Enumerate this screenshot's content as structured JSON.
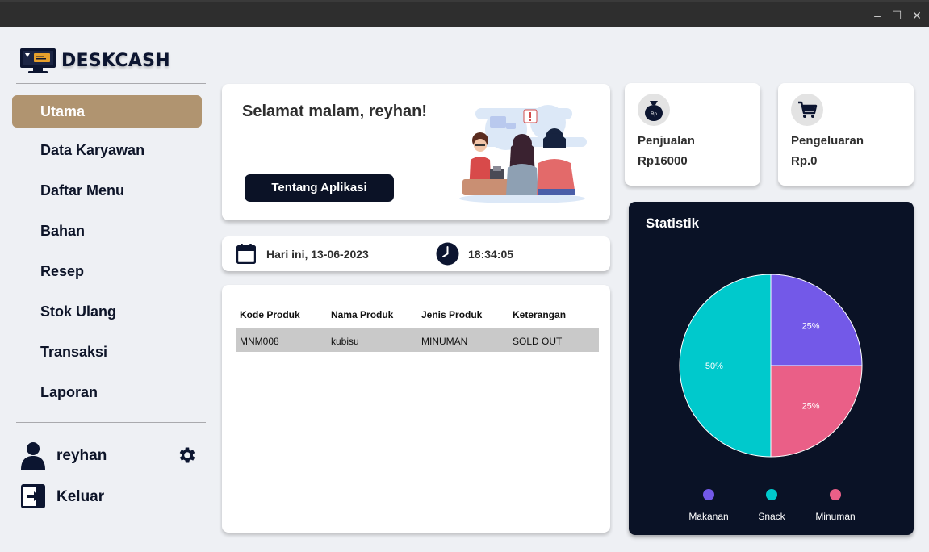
{
  "window": {
    "minimize": "–",
    "maximize": "☐",
    "close": "✕"
  },
  "app": {
    "title": "DESKCASH"
  },
  "nav": {
    "items": [
      {
        "label": "Utama"
      },
      {
        "label": "Data Karyawan"
      },
      {
        "label": "Daftar Menu"
      },
      {
        "label": "Bahan"
      },
      {
        "label": "Resep"
      },
      {
        "label": "Stok Ulang"
      },
      {
        "label": "Transaksi"
      },
      {
        "label": "Laporan"
      }
    ],
    "active_index": 0
  },
  "user": {
    "name": "reyhan",
    "logout_label": "Keluar"
  },
  "greeting": {
    "text": "Selamat malam, reyhan!",
    "about_button": "Tentang Aplikasi"
  },
  "datetime": {
    "date": "Hari ini, 13-06-2023",
    "time": "18:34:05"
  },
  "table": {
    "headers": [
      "Kode Produk",
      "Nama Produk",
      "Jenis Produk",
      "Keterangan"
    ],
    "rows": [
      [
        "MNM008",
        "kubisu",
        "MINUMAN",
        "SOLD OUT"
      ]
    ]
  },
  "stats": {
    "sales": {
      "label": "Penjualan",
      "value": "Rp16000",
      "badge": "Rp"
    },
    "expenses": {
      "label": "Pengeluaran",
      "value": "Rp.0"
    }
  },
  "colors": {
    "accent": "#b09470",
    "dark": "#0a1226",
    "makanan": "#7359e8",
    "snack": "#00c9cc",
    "minuman": "#ea5f87"
  },
  "chart_data": {
    "type": "pie",
    "title": "Statistik",
    "categories": [
      "Makanan",
      "Snack",
      "Minuman"
    ],
    "values": [
      25,
      50,
      25
    ],
    "value_labels": [
      "25%",
      "50%",
      "25%"
    ],
    "legend_position": "bottom"
  }
}
